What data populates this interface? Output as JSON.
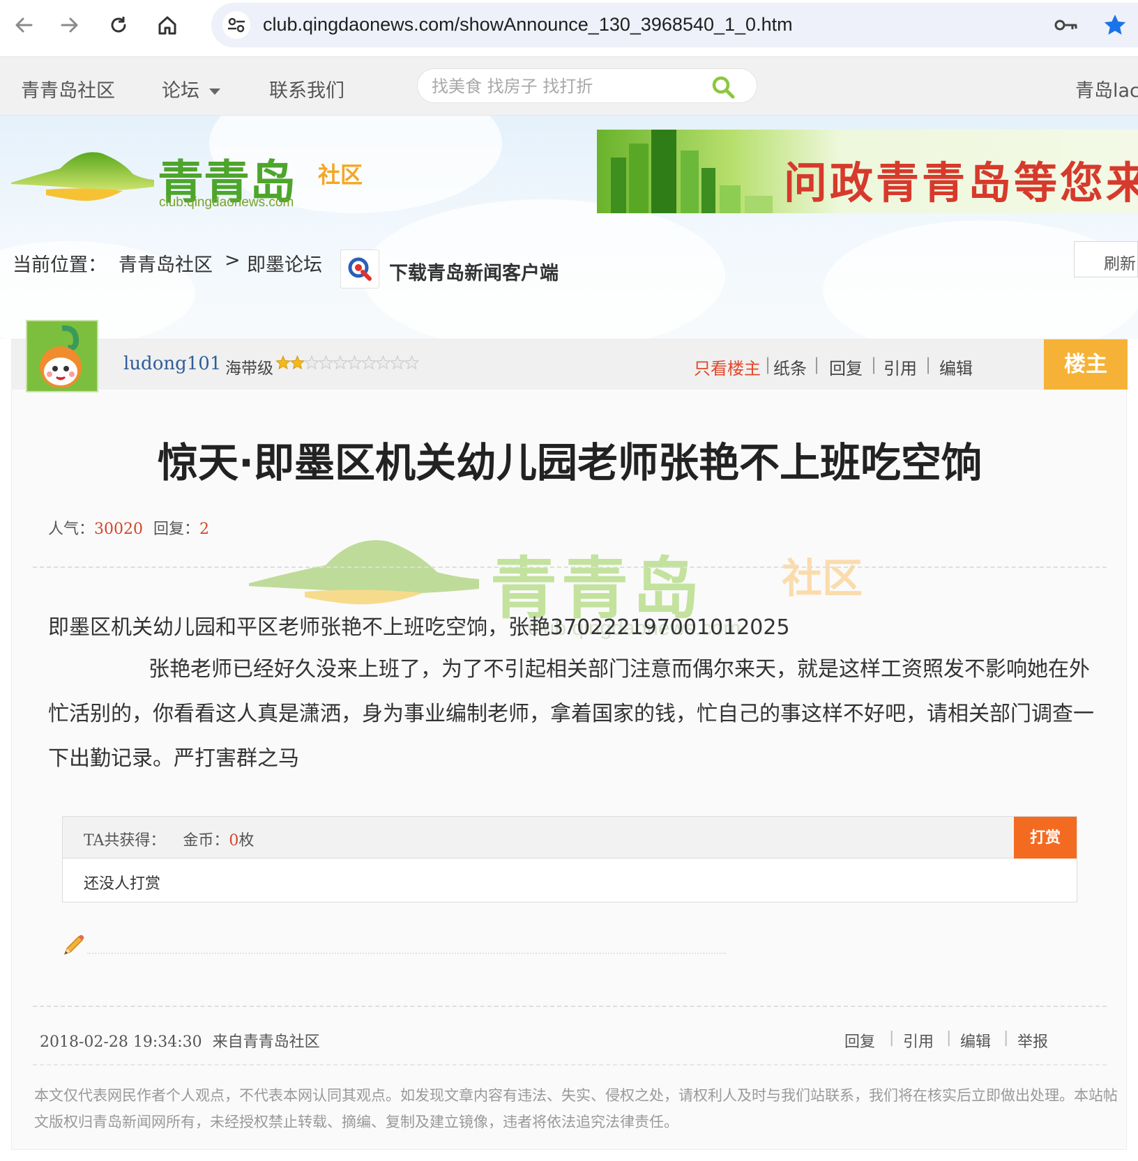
{
  "browser": {
    "url": "club.qingdaonews.com/showAnnounce_130_3968540_1_0.htm"
  },
  "topbar": {
    "site_name": "青青岛社区",
    "forum": "论坛",
    "contact": "联系我们",
    "search_placeholder": "找美食 找房子 找打折",
    "right_text": "青岛lac"
  },
  "header": {
    "logo_text": "青青岛",
    "logo_sub": "社区",
    "logo_url": "club.qingdaonews.com",
    "banner_text": "问政青青岛等您来",
    "breadcrumb_label": "当前位置：",
    "breadcrumb_home": "青青岛社区",
    "breadcrumb_sep": ">",
    "breadcrumb_forum": "即墨论坛",
    "app_download": "下载青岛新闻客户端",
    "refresh": "刷新"
  },
  "post": {
    "username": "ludong101",
    "rank": "海带级",
    "rank_stars_filled": 2,
    "rank_stars_total": 10,
    "actions": {
      "only_op": "只看楼主",
      "note": "纸条",
      "reply": "回复",
      "quote": "引用",
      "edit": "编辑"
    },
    "op_badge": "楼主",
    "title": "惊天·即墨区机关幼儿园老师张艳不上班吃空饷",
    "stats": {
      "popularity_label": "人气：",
      "popularity": "30020",
      "replies_label": "回复：",
      "replies": "2"
    },
    "watermark": {
      "text": "青青岛",
      "sub": "社区",
      "url": "club.qingdaonews.com"
    },
    "paragraph1": "即墨区机关幼儿园和平区老师张艳不上班吃空饷，张艳370222197001012025",
    "paragraph2": "张艳老师已经好久没来上班了，为了不引起相关部门注意而偶尔来天，就是这样工资照发不影响她在外忙活别的，你看看这人真是潇洒，身为事业编制老师，拿着国家的钱，忙自己的事这样不好吧，请相关部门调查一下出勤记录。严打害群之马",
    "reward": {
      "label": "TA共获得：",
      "coins_label": "金币：",
      "coins": "0",
      "unit": "枚",
      "button": "打赏",
      "none": "还没人打赏"
    },
    "footer": {
      "datetime": "2018-02-28 19:34:30",
      "source": "来自青青岛社区",
      "reply": "回复",
      "quote": "引用",
      "edit": "编辑",
      "report": "举报"
    },
    "disclaimer": "本文仅代表网民作者个人观点，不代表本网认同其观点。如发现文章内容有违法、失实、侵权之处，请权利人及时与我们站联系，我们将在核实后立即做出处理。本站帖文版权归青岛新闻网所有，未经授权禁止转载、摘编、复制及建立镜像，违者将依法追究法律责任。"
  },
  "colors": {
    "accent_orange": "#f6b237",
    "reward_button": "#f36b21",
    "number_red": "#d0462b",
    "link_blue": "#2f5d9a",
    "only_op_red": "#e0482a",
    "logo_green": "#5aa81e"
  }
}
